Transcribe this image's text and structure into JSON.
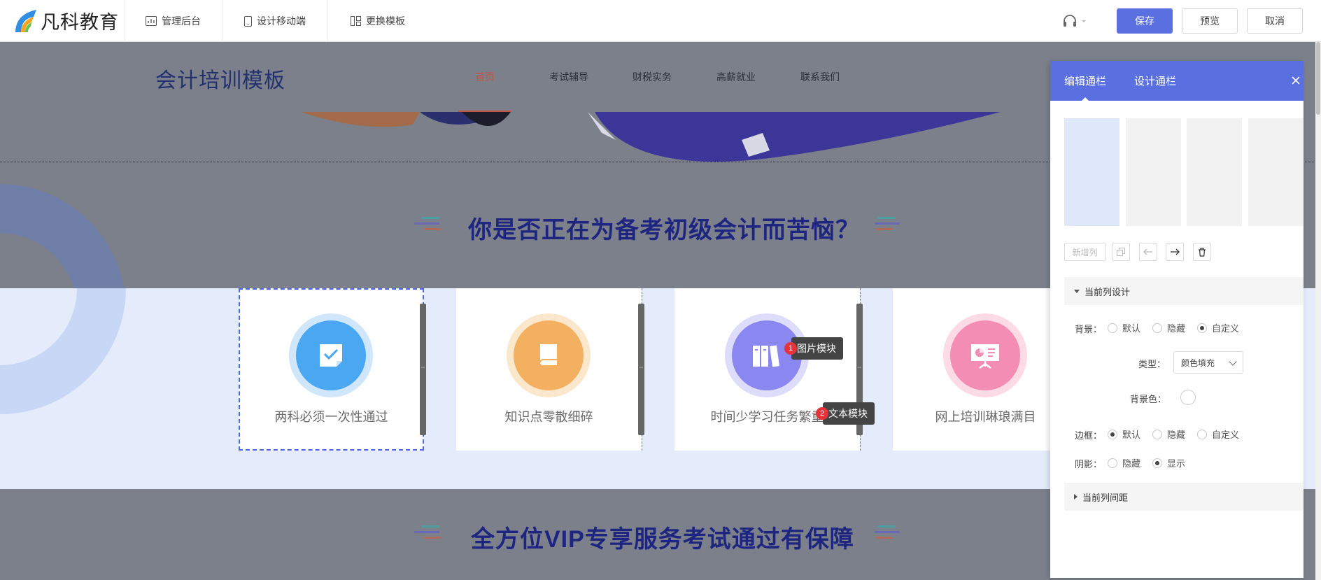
{
  "app": {
    "logo_text": "凡科教育"
  },
  "toolbar": {
    "links": [
      {
        "label": "管理后台",
        "icon": "chart-icon"
      },
      {
        "label": "设计移动端",
        "icon": "mobile-icon"
      },
      {
        "label": "更换模板",
        "icon": "template-icon"
      }
    ],
    "support_icon": "headset-icon",
    "save_label": "保存",
    "preview_label": "预览",
    "cancel_label": "取消"
  },
  "site": {
    "title": "会计培训模板",
    "nav": [
      "首页",
      "考试辅导",
      "财税实务",
      "高薪就业",
      "联系我们"
    ],
    "nav_active_index": 0,
    "section1_title": "你是否正在为备考初级会计而苦恼？",
    "cards": [
      {
        "label": "两科必须一次性通过",
        "icon": "check-document-icon",
        "color": "#4aa8f2",
        "ring": "#cfe6fb"
      },
      {
        "label": "知识点零散细碎",
        "icon": "book-icon",
        "color": "#f2b060",
        "ring": "#fbe7cc"
      },
      {
        "label": "时间少学习任务繁重",
        "icon": "books-icon",
        "color": "#8a88f0",
        "ring": "#dedcfb"
      },
      {
        "label": "网上培训琳琅满目",
        "icon": "presentation-icon",
        "color": "#f48db4",
        "ring": "#fcdbe7"
      }
    ],
    "section2_title": "全方位VIP专享服务考试通过有保障"
  },
  "tags": [
    {
      "num": "1",
      "label": "图片模块"
    },
    {
      "num": "2",
      "label": "文本模块"
    }
  ],
  "panel": {
    "tabs": [
      "编辑通栏",
      "设计通栏"
    ],
    "active_tab": 0,
    "column_count": 4,
    "active_column": 0,
    "tools": {
      "add_column": "新增列"
    },
    "group_current_design": "当前列设计",
    "background_label": "背景：",
    "background_options": [
      "默认",
      "隐藏",
      "自定义"
    ],
    "background_selected": 2,
    "type_label": "类型：",
    "type_value": "颜色填充",
    "bgcolor_label": "背景色：",
    "border_label": "边框：",
    "border_options": [
      "默认",
      "隐藏",
      "自定义"
    ],
    "border_selected": 0,
    "shadow_label": "阴影：",
    "shadow_options": [
      "隐藏",
      "显示"
    ],
    "shadow_selected": 1,
    "group_spacing": "当前列间距"
  }
}
